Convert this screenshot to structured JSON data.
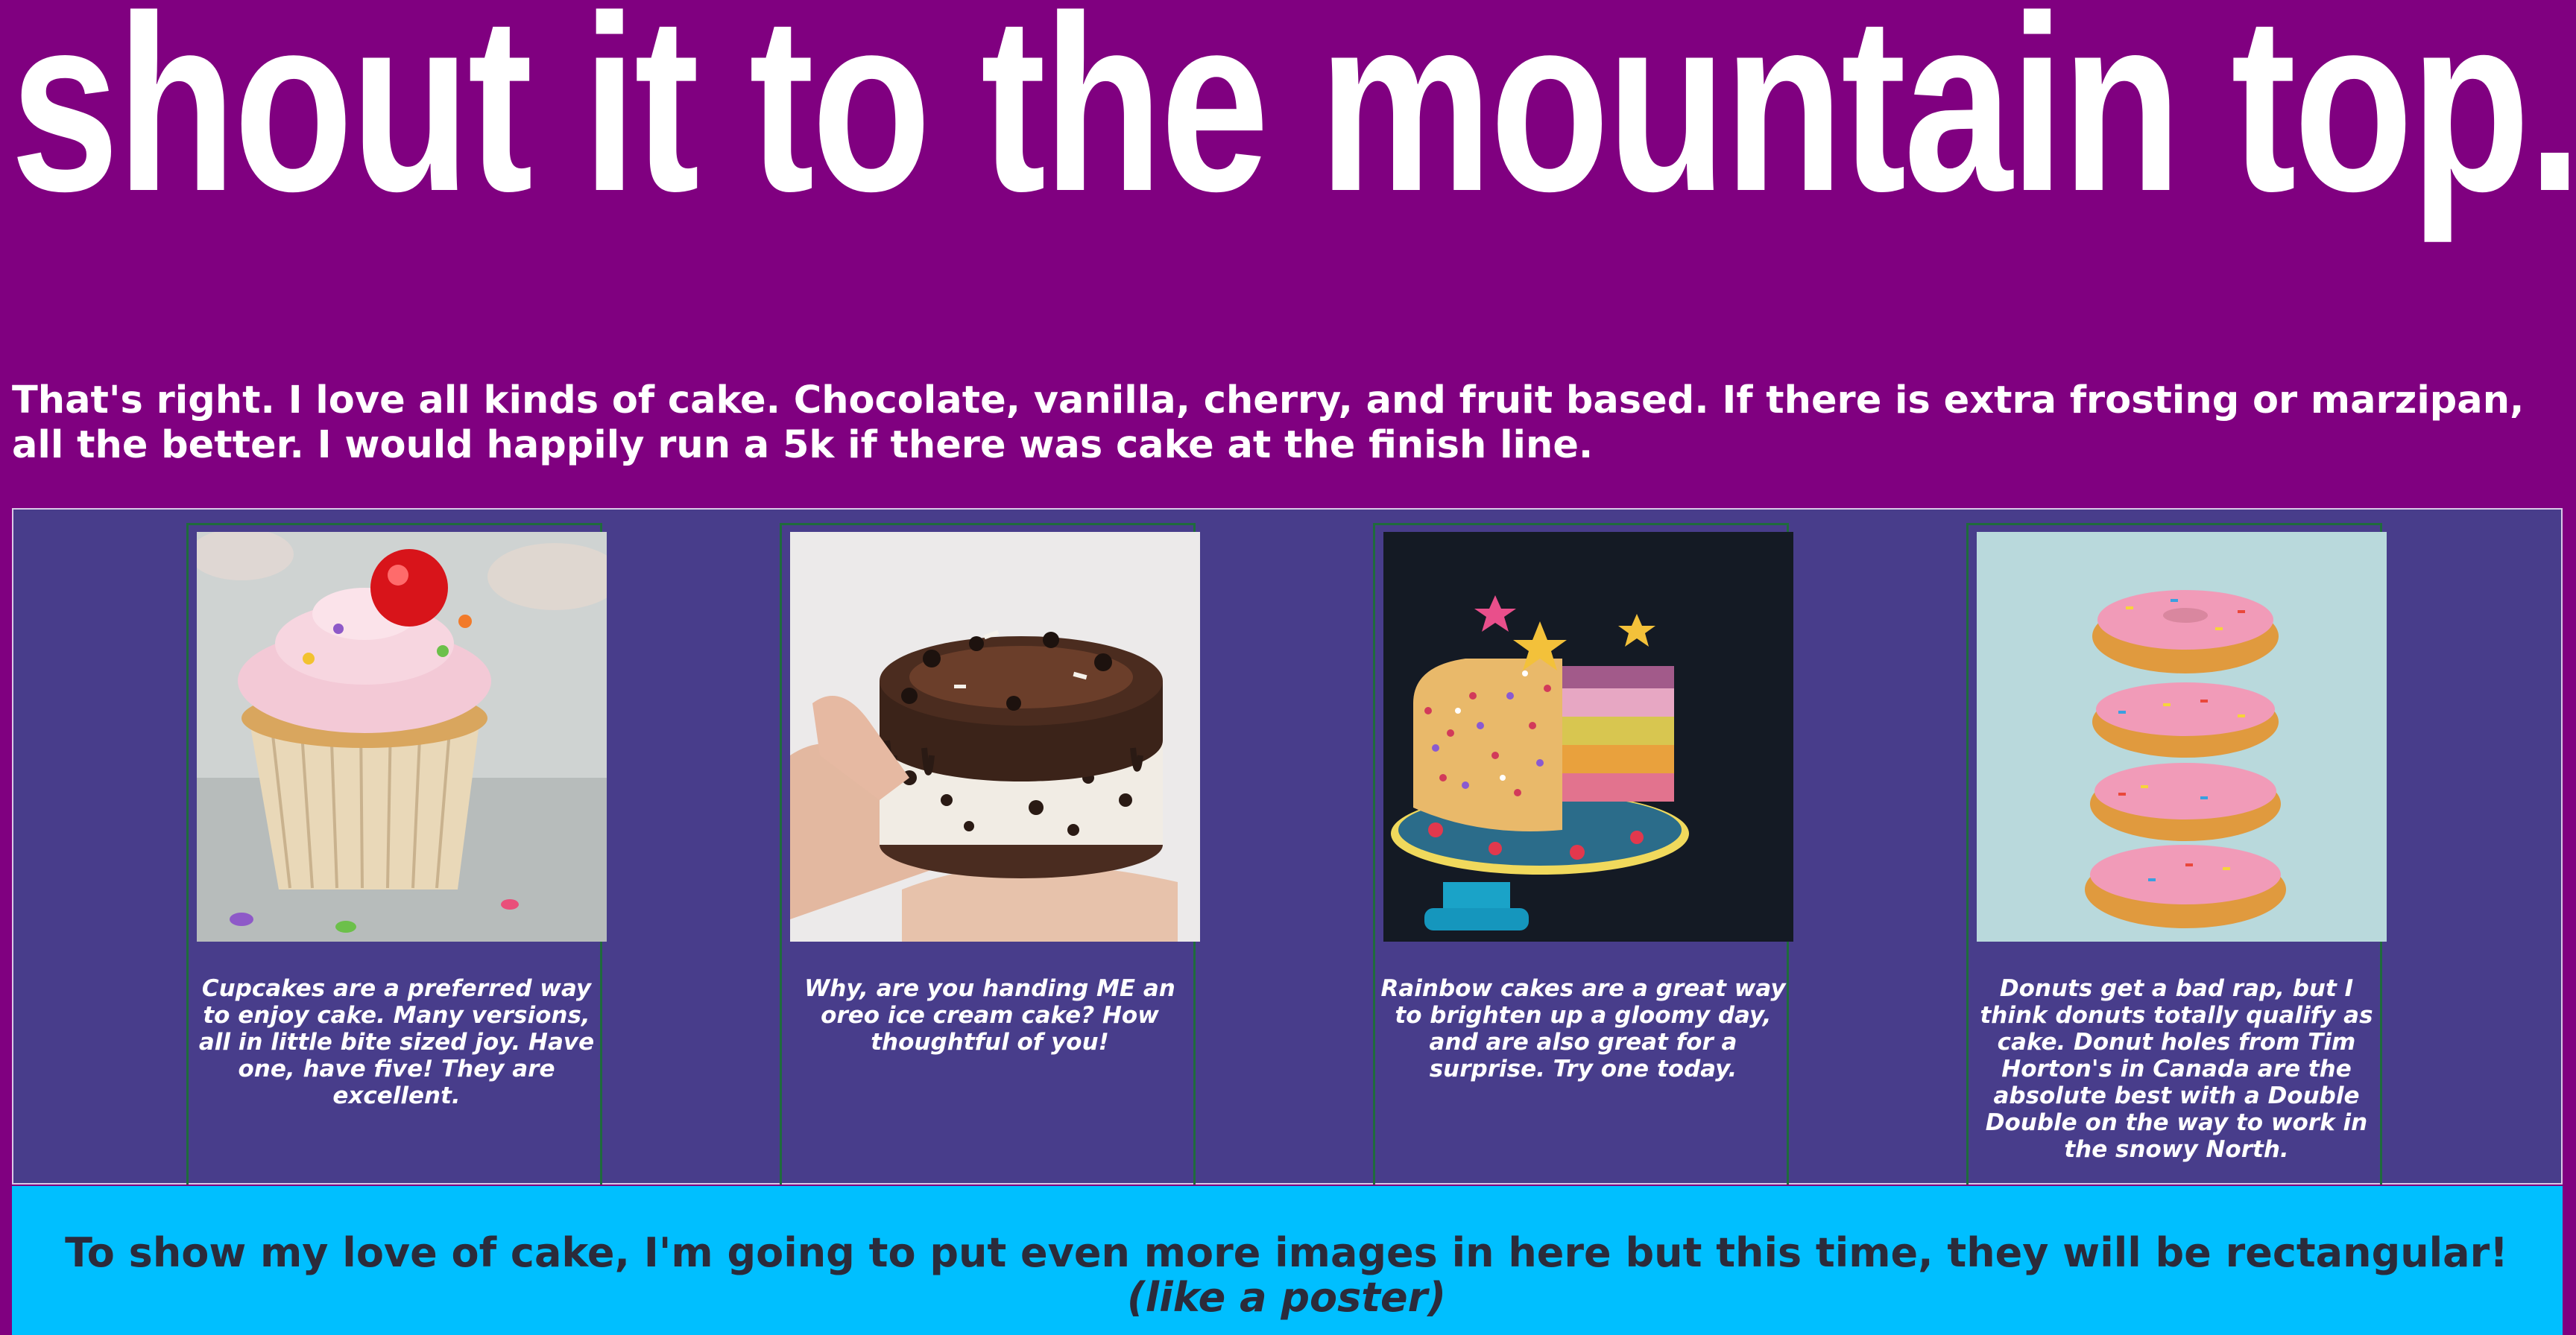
{
  "headline": "shout it to the mountain top.",
  "intro": "That's right. I love all kinds of cake. Chocolate, vanilla, cherry, and fruit based. If there is extra frosting or marzipan, all the better. I would happily run a 5k if there was cake at the finish line.",
  "gallery": {
    "cards": [
      {
        "image": "cupcake-photo",
        "caption": "Cupcakes are a preferred way to enjoy cake. Many versions, all in little bite sized joy. Have one, have five! They are excellent."
      },
      {
        "image": "oreo-ice-cream-cake-photo",
        "caption": "Why, are you handing ME an oreo ice cream cake? How thoughtful of you!"
      },
      {
        "image": "rainbow-cake-photo",
        "caption": "Rainbow cakes are a great way to brighten up a gloomy day, and are also great for a surprise. Try one today."
      },
      {
        "image": "donut-stack-photo",
        "caption": "Donuts get a bad rap, but I think donuts totally qualify as cake. Donut holes from Tim Horton's in Canada are the absolute best with a Double Double on the way to work in the snowy North."
      }
    ]
  },
  "banner": {
    "text": "To show my love of cake, I'm going to put even more images in here but this time, they will be rectangular!",
    "emphasis": "(like a poster)"
  },
  "colors": {
    "page_background": "#800080",
    "gallery_background": "#483d8b",
    "banner_background": "#00bfff",
    "card_border": "#1f6b3c",
    "headline_text": "#ffffff",
    "banner_text": "#2b2b3b"
  }
}
